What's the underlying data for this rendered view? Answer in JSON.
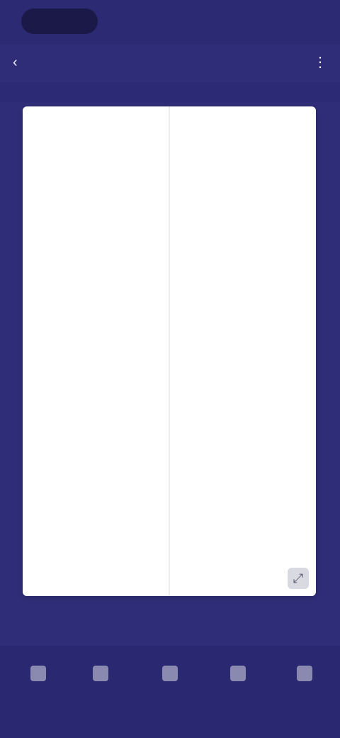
{
  "status_bar": {
    "right_text": ""
  },
  "header": {
    "title": "",
    "back_icon": "back-icon",
    "more_icon": "more-icon"
  },
  "table": {
    "columns": [
      "",
      ""
    ],
    "rows": [
      [
        "",
        ""
      ],
      [
        "",
        ""
      ],
      [
        "",
        ""
      ],
      [
        "",
        ""
      ],
      [
        "",
        ""
      ]
    ]
  },
  "footer": {
    "left_text": "",
    "right_text": ""
  },
  "bottom_nav": {
    "items": [
      {
        "label": "",
        "icon": "nav-icon"
      },
      {
        "label": "",
        "icon": "nav-icon"
      },
      {
        "label": "",
        "icon": "nav-icon"
      },
      {
        "label": "",
        "icon": "nav-icon"
      },
      {
        "label": "",
        "icon": "nav-icon"
      }
    ]
  },
  "colors": {
    "background": "#2f2d77",
    "card": "#ffffff"
  }
}
